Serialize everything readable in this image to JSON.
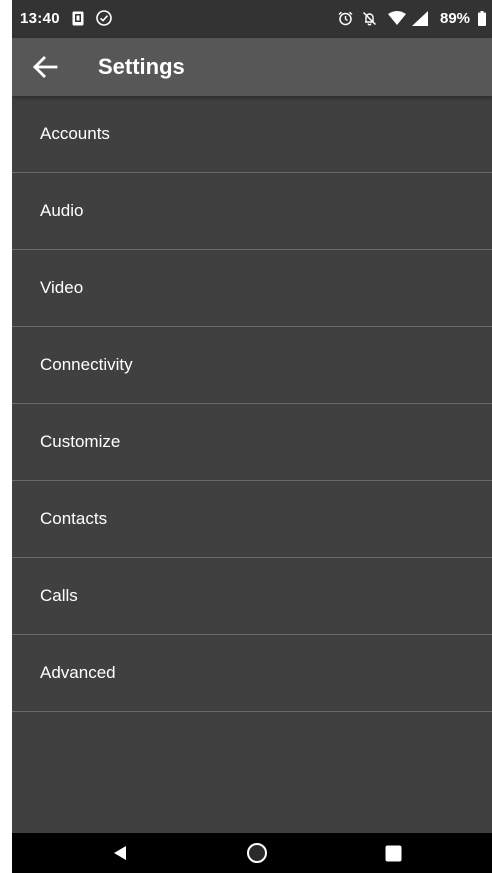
{
  "status_bar": {
    "time": "13:40",
    "battery_percent": "89%",
    "icons": [
      "sim-card-icon",
      "check-circle-icon",
      "alarm-icon",
      "notifications-off-icon",
      "wifi-icon",
      "signal-icon",
      "battery-icon"
    ]
  },
  "app_bar": {
    "title": "Settings",
    "back_icon": "arrow-back-icon"
  },
  "settings": {
    "items": [
      {
        "label": "Accounts"
      },
      {
        "label": "Audio"
      },
      {
        "label": "Video"
      },
      {
        "label": "Connectivity"
      },
      {
        "label": "Customize"
      },
      {
        "label": "Contacts"
      },
      {
        "label": "Calls"
      },
      {
        "label": "Advanced"
      }
    ]
  },
  "nav_bar": {
    "icons": [
      "back-triangle-icon",
      "home-circle-icon",
      "recents-square-icon"
    ]
  },
  "colors": {
    "status_bar": "#333333",
    "app_bar": "#575757",
    "background": "#404040",
    "divider": "#6a6a6a",
    "nav_bar": "#000000",
    "text": "#ffffff"
  }
}
